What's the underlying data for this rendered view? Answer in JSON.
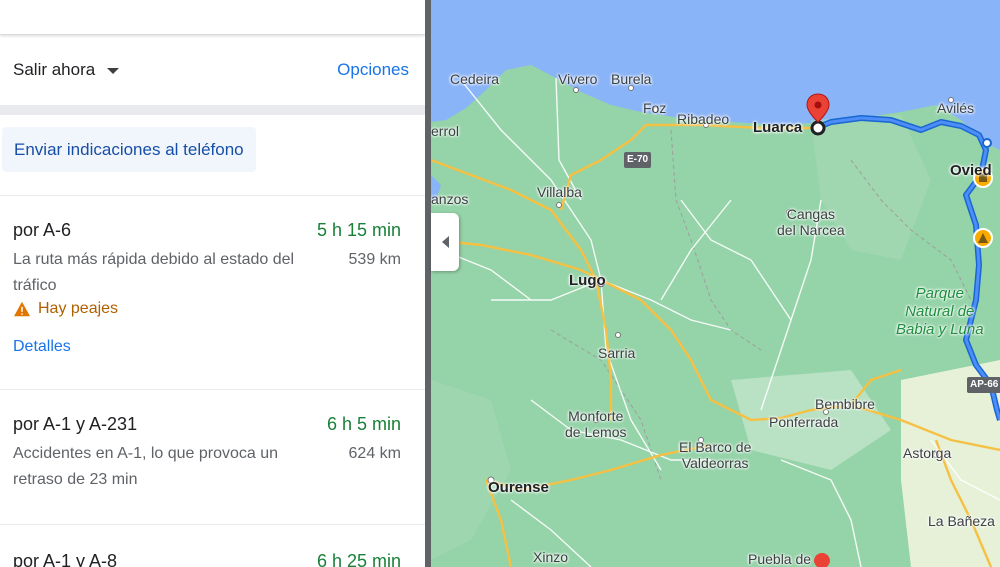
{
  "directions": {
    "depart_label": "Salir ahora",
    "options_label": "Opciones",
    "send_label": "Enviar indicaciones al teléfono",
    "routes": [
      {
        "name": "por A-6",
        "time": "5 h 15 min",
        "desc": "La ruta más rápida debido al estado del tráfico",
        "distance": "539 km",
        "warning": "Hay peajes",
        "details_label": "Detalles"
      },
      {
        "name": "por A-1 y A-231",
        "time": "6 h 5 min",
        "desc": "Accidentes en A-1, lo que provoca un retraso de 23 min",
        "distance": "624 km"
      },
      {
        "name": "por A-1 y A-8",
        "time": "6 h 25 min"
      }
    ]
  },
  "map": {
    "places": {
      "cedeira": "Cedeira",
      "vivero": "Vivero",
      "burela": "Burela",
      "foz": "Foz",
      "ribadeo": "Ribadeo",
      "luarca": "Luarca",
      "aviles": "Avilés",
      "oviedo": "Ovied",
      "ferrol": "errol",
      "villalba": "Villalba",
      "anzos": "anzos",
      "cangas": "Cangas\ndel Narcea",
      "lugo": "Lugo",
      "sarria": "Sarria",
      "monforte": "Monforte\nde Lemos",
      "ponferrada": "Ponferrada",
      "bembibre": "Bembibre",
      "barco": "El Barco de\nValdeorras",
      "astorga": "Astorga",
      "ourense": "Ourense",
      "xinzo": "Xinzo",
      "puebla": "Puebla de",
      "baneza": "La Bañeza",
      "park": "Parque\nNatural de\nBabia y Luna"
    },
    "roads": {
      "e70": "E-70",
      "ap66": "AP-66"
    },
    "colors": {
      "sea": "#8ab4f8",
      "land": "#95d3a8",
      "route": "#1a73e8",
      "major_road": "#f9c94e"
    }
  }
}
